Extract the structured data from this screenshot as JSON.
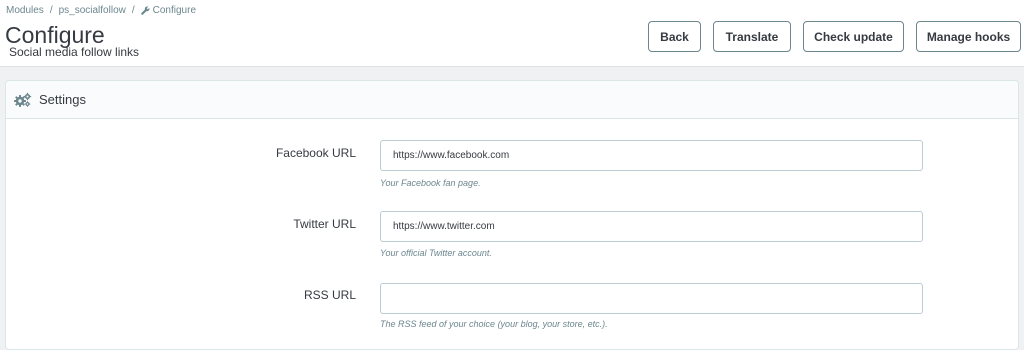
{
  "breadcrumb": {
    "items": [
      "Modules",
      "ps_socialfollow",
      "Configure"
    ],
    "separator": "/"
  },
  "page": {
    "title": "Configure",
    "subtitle": "Social media follow links"
  },
  "toolbar": {
    "back_label": "Back",
    "translate_label": "Translate",
    "check_update_label": "Check update",
    "manage_hooks_label": "Manage hooks"
  },
  "panel": {
    "heading": "Settings",
    "icon": "cogs-icon"
  },
  "form": {
    "facebook": {
      "label": "Facebook URL",
      "value": "https://www.facebook.com",
      "help": "Your Facebook fan page."
    },
    "twitter": {
      "label": "Twitter URL",
      "value": "https://www.twitter.com",
      "help": "Your official Twitter account."
    },
    "rss": {
      "label": "RSS URL",
      "value": "",
      "help": "The RSS feed of your choice (your blog, your store, etc.)."
    }
  },
  "colors": {
    "background": "#eff1f2",
    "text": "#363a41",
    "muted": "#6c868e",
    "input_border": "#bbcdd2",
    "panel_border": "#dbe6e9"
  }
}
